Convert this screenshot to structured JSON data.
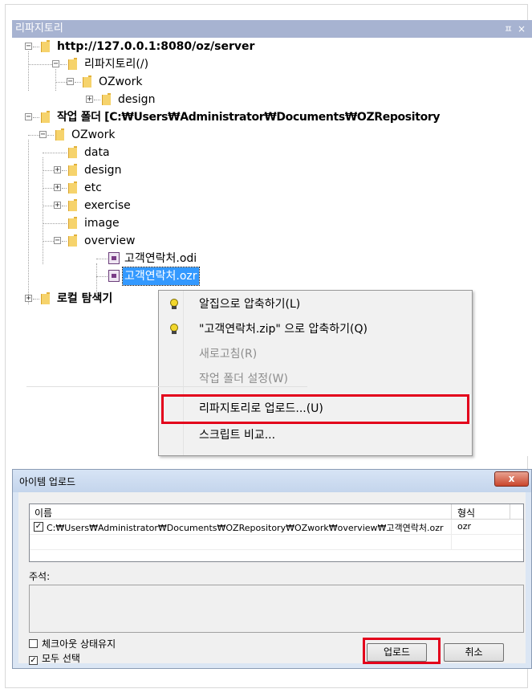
{
  "panel": {
    "title": "리파지토리",
    "pin_glyph": "ㅍ",
    "close_glyph": "×",
    "tree": [
      {
        "label": "http://127.0.0.1:8080/oz/server",
        "bold": true
      },
      {
        "label": "리파지토리(/)"
      },
      {
        "label": "OZwork"
      },
      {
        "label": "design"
      },
      {
        "label": "작업 폴더 [C:₩Users₩Administrator₩Documents₩OZRepository",
        "bold": true
      },
      {
        "label": "OZwork"
      },
      {
        "label": "data"
      },
      {
        "label": "design"
      },
      {
        "label": "etc"
      },
      {
        "label": "exercise"
      },
      {
        "label": "image"
      },
      {
        "label": "overview"
      },
      {
        "label": "고객연락처.odi"
      },
      {
        "label": "고객연락처.ozr",
        "selected": true
      },
      {
        "label": "로컬 탐색기",
        "bold": true
      }
    ]
  },
  "context_menu": {
    "items": [
      {
        "label": "알집으로 압축하기(L)",
        "icon": "alzip-icon",
        "disabled": false
      },
      {
        "label": "\"고객연락처.zip\" 으로 압축하기(Q)",
        "icon": "alzip-icon",
        "disabled": false
      },
      {
        "label": "새로고침(R)",
        "disabled": true
      },
      {
        "label": "작업 폴더 설정(W)",
        "disabled": true
      },
      {
        "label": "리파지토리로 업로드...(U)",
        "disabled": false,
        "highlighted": true
      },
      {
        "label": "스크립트 비교...",
        "disabled": false
      }
    ]
  },
  "dialog": {
    "title": "아이템 업로드",
    "close_glyph": "x",
    "columns": [
      "이름",
      "형식"
    ],
    "rows": [
      {
        "checked": true,
        "path": "C:₩Users₩Administrator₩Documents₩OZRepository₩OZwork₩overview₩고객연락처.ozr",
        "format": "ozr"
      }
    ],
    "note_label": "주석:",
    "note_value": "",
    "keep_checkout_label": "체크아웃 상태유지",
    "keep_checkout_checked": false,
    "select_all_label": "모두 선택",
    "select_all_checked": true,
    "upload_button": "업로드",
    "cancel_button": "취소"
  },
  "colors": {
    "panel_title_bg": "#a7b3d1",
    "selection": "#3399ff",
    "highlight_box": "#e3001b",
    "dialog_frame": "#dbe6f4"
  }
}
